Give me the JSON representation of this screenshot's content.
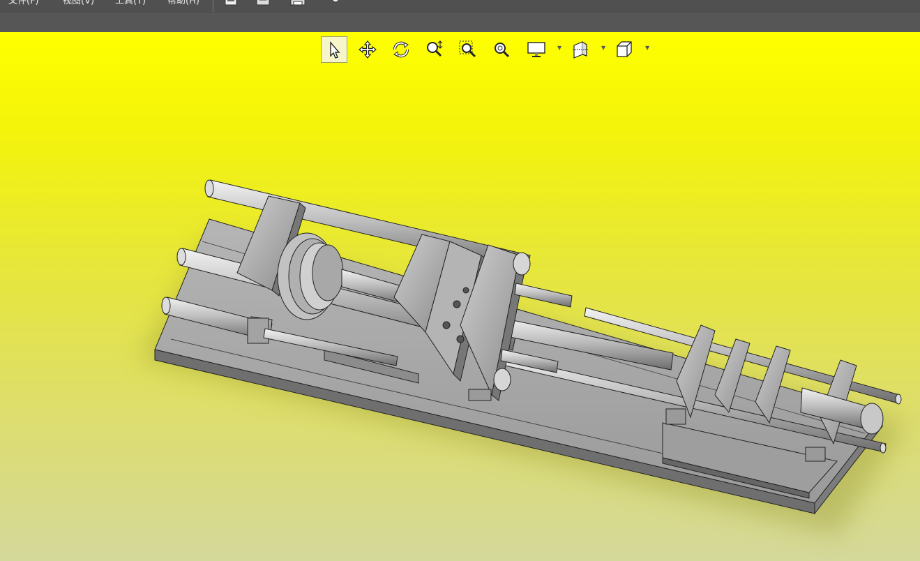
{
  "menubar": {
    "items": [
      "文件(F)",
      "视图(V)",
      "工具(T)",
      "帮助(H)"
    ],
    "icons": [
      "open-file-icon",
      "save-icon",
      "print-icon",
      "settings-icon"
    ]
  },
  "view_toolbar": {
    "buttons": [
      {
        "name": "select-icon",
        "tooltip": "Select"
      },
      {
        "name": "pan-icon",
        "tooltip": "Pan"
      },
      {
        "name": "rotate-icon",
        "tooltip": "Rotate"
      },
      {
        "name": "zoom-icon",
        "tooltip": "Zoom"
      },
      {
        "name": "zoom-window-icon",
        "tooltip": "Zoom to area"
      },
      {
        "name": "zoom-fit-icon",
        "tooltip": "Zoom to fit"
      },
      {
        "name": "display-mode-icon",
        "tooltip": "Display"
      },
      {
        "name": "section-view-icon",
        "tooltip": "Section"
      },
      {
        "name": "standard-views-icon",
        "tooltip": "Views"
      }
    ]
  },
  "viewport": {
    "background_top": "#ffff00",
    "background_bottom": "#d4d89a",
    "model_color": "#a9a9a9",
    "edge_color": "#222222"
  }
}
